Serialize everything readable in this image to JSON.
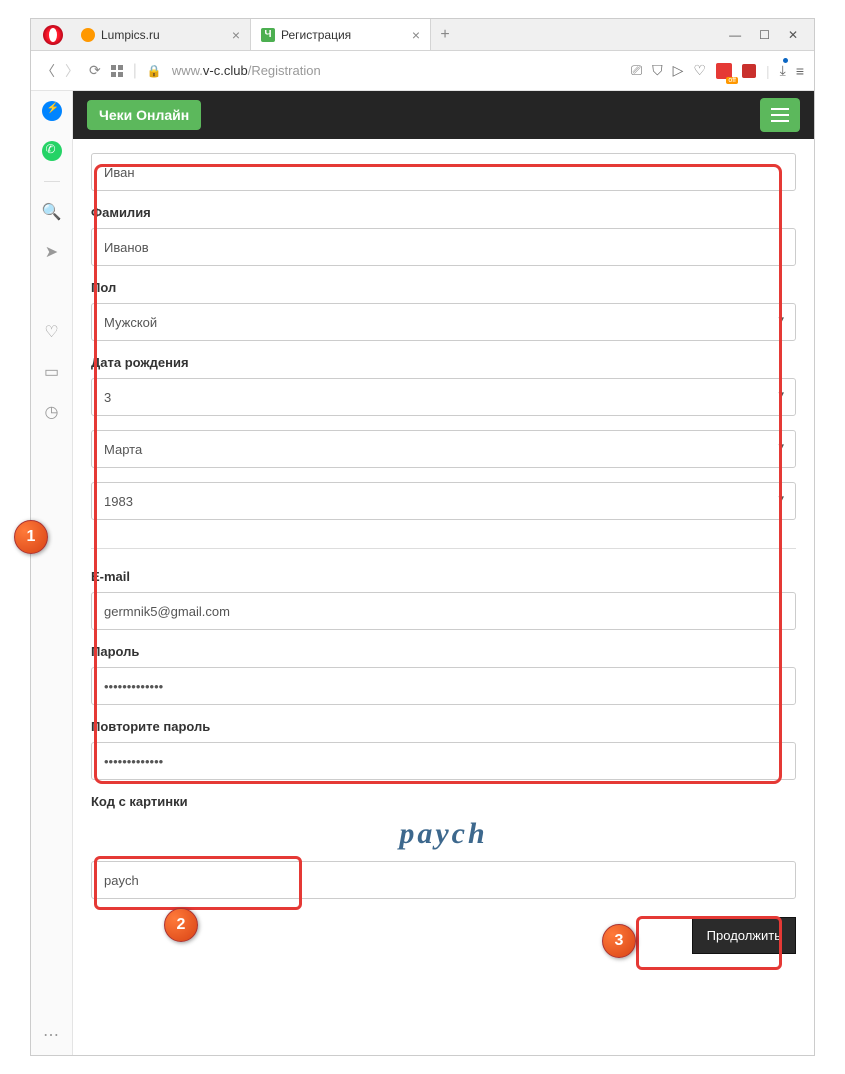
{
  "browser": {
    "tabs": [
      {
        "title": "Lumpics.ru",
        "active": false
      },
      {
        "title": "Регистрация",
        "active": true,
        "favletter": "Ч"
      }
    ],
    "url_prefix": "www.",
    "url_domain": "v-c.club",
    "url_path": "/Registration"
  },
  "navbar": {
    "brand": "Чеки Онлайн"
  },
  "form": {
    "first_name": {
      "value": "Иван"
    },
    "last_name": {
      "label": "Фамилия",
      "value": "Иванов"
    },
    "gender": {
      "label": "Пол",
      "value": "Мужской"
    },
    "dob": {
      "label": "Дата рождения",
      "day": "3",
      "month": "Марта",
      "year": "1983"
    },
    "email": {
      "label": "E-mail",
      "value": "germnik5@gmail.com"
    },
    "password": {
      "label": "Пароль",
      "value": "•••••••••••••"
    },
    "password2": {
      "label": "Повторите пароль",
      "value": "•••••••••••••"
    },
    "captcha": {
      "label": "Код с картинки",
      "image_text": "paych",
      "value": "paych"
    },
    "submit": "Продолжить"
  },
  "annotations": {
    "b1": "1",
    "b2": "2",
    "b3": "3"
  }
}
